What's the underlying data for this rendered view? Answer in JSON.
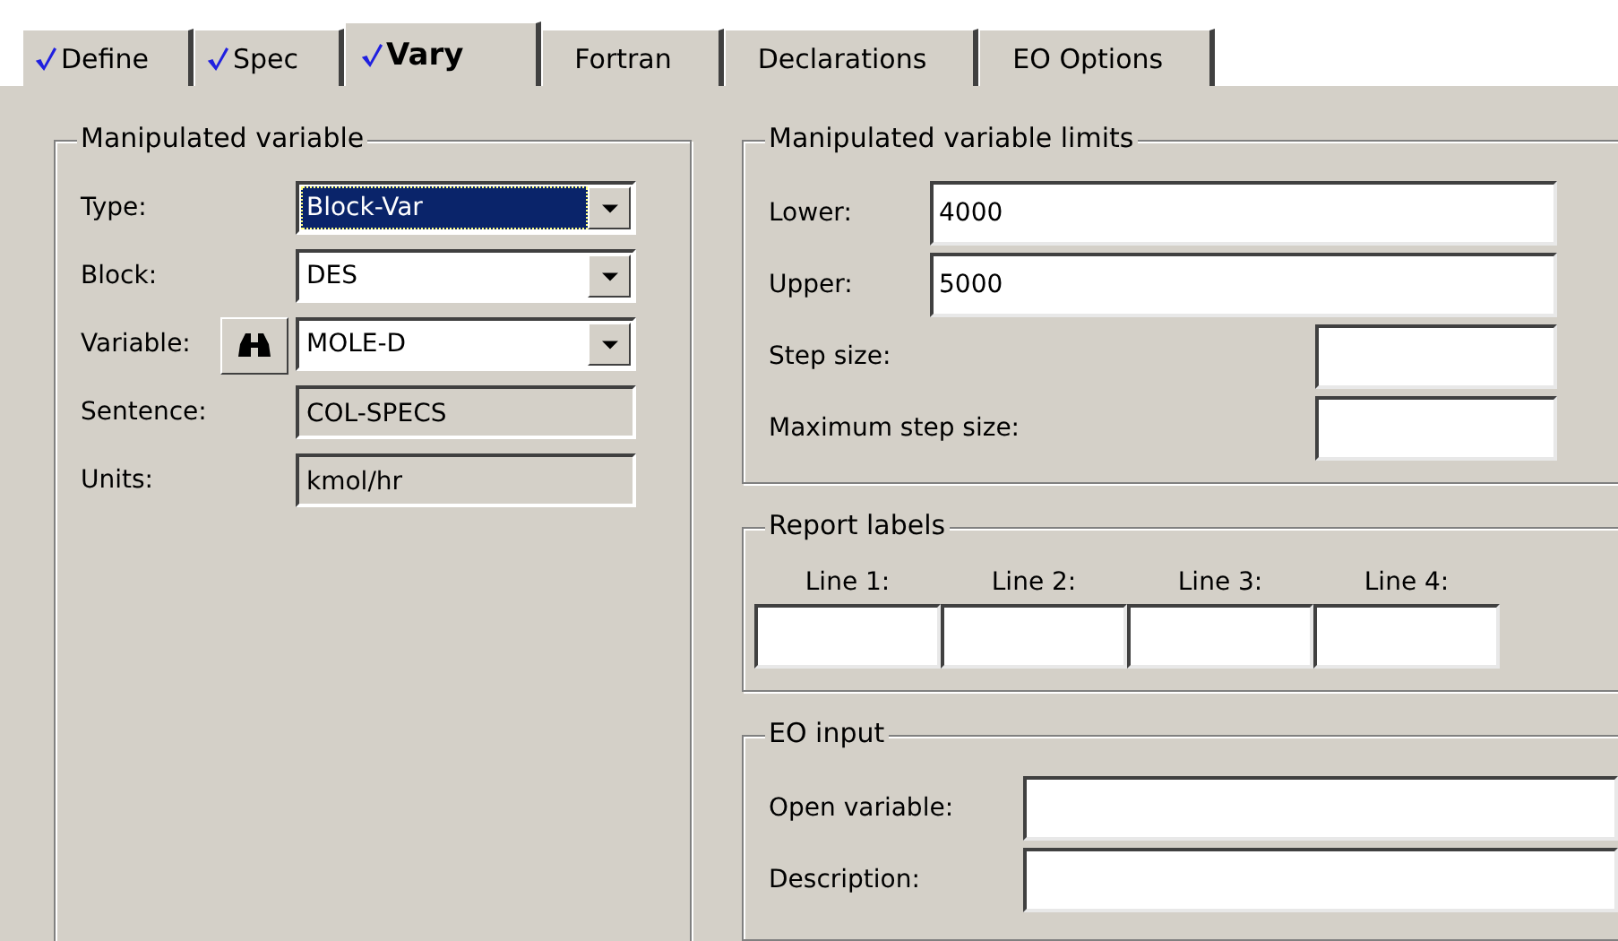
{
  "tabs": [
    {
      "label": "Define",
      "checked": true,
      "selected": false
    },
    {
      "label": "Spec",
      "checked": true,
      "selected": false
    },
    {
      "label": "Vary",
      "checked": true,
      "selected": true
    },
    {
      "label": "Fortran",
      "checked": false,
      "selected": false
    },
    {
      "label": "Declarations",
      "checked": false,
      "selected": false
    },
    {
      "label": "EO Options",
      "checked": false,
      "selected": false
    }
  ],
  "manipulated_variable": {
    "title": "Manipulated variable",
    "fields": [
      {
        "label": "Type:",
        "kind": "dropdown",
        "value": "Block-Var",
        "focused": true,
        "finder": false
      },
      {
        "label": "Block:",
        "kind": "dropdown",
        "value": "DES",
        "focused": false,
        "finder": false
      },
      {
        "label": "Variable:",
        "kind": "dropdown",
        "value": "MOLE-D",
        "focused": false,
        "finder": true
      },
      {
        "label": "Sentence:",
        "kind": "readonly",
        "value": "COL-SPECS",
        "focused": false,
        "finder": false
      },
      {
        "label": "Units:",
        "kind": "readonly",
        "value": "kmol/hr",
        "focused": false,
        "finder": false
      }
    ]
  },
  "limits": {
    "title": "Manipulated variable limits",
    "fields": [
      {
        "label": "Lower:",
        "kind": "wide",
        "value": "4000"
      },
      {
        "label": "Upper:",
        "kind": "wide",
        "value": "5000"
      },
      {
        "label": "Step size:",
        "kind": "short"
      },
      {
        "label": "Maximum step size:",
        "kind": "short"
      }
    ]
  },
  "report_labels": {
    "title": "Report labels",
    "lines": [
      {
        "label": "Line 1:"
      },
      {
        "label": "Line 2:"
      },
      {
        "label": "Line 3:"
      },
      {
        "label": "Line 4:"
      }
    ]
  },
  "eo_input": {
    "title": "EO input",
    "fields": [
      {
        "label": "Open variable:"
      },
      {
        "label": "Description:"
      }
    ]
  }
}
